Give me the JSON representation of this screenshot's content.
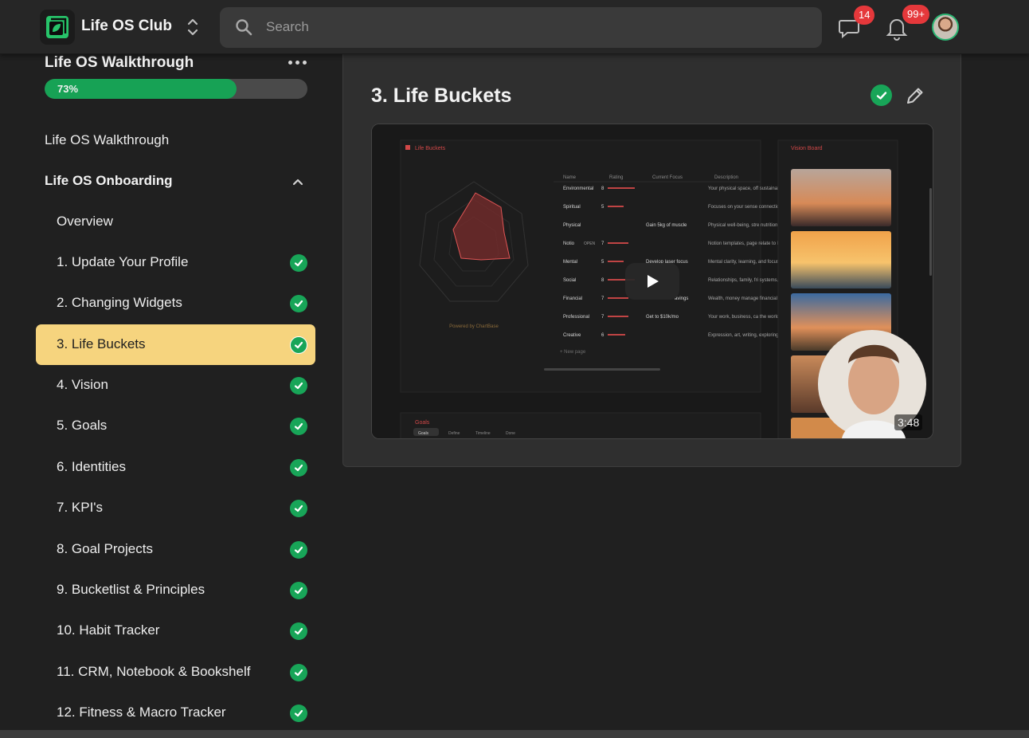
{
  "header": {
    "club_name": "Life OS Club",
    "search_placeholder": "Search",
    "messages_badge": "14",
    "notifications_badge": "99+"
  },
  "sidebar": {
    "course_title": "Life OS Walkthrough",
    "progress": {
      "value_percent": 73,
      "label": "73%"
    },
    "links": [
      {
        "label": "Life OS Walkthrough"
      }
    ],
    "section": {
      "title": "Life OS Onboarding",
      "expanded": true
    },
    "items": [
      {
        "label": "Overview",
        "completed": false
      },
      {
        "label": "1. Update Your Profile",
        "completed": true
      },
      {
        "label": "2. Changing Widgets",
        "completed": true
      },
      {
        "label": "3. Life Buckets",
        "completed": true,
        "active": true
      },
      {
        "label": "4. Vision",
        "completed": true
      },
      {
        "label": "5. Goals",
        "completed": true
      },
      {
        "label": "6. Identities",
        "completed": true
      },
      {
        "label": "7. KPI's",
        "completed": true
      },
      {
        "label": "8. Goal Projects",
        "completed": true
      },
      {
        "label": "9. Bucketlist & Principles",
        "completed": true
      },
      {
        "label": "10. Habit Tracker",
        "completed": true
      },
      {
        "label": "11. CRM, Notebook & Bookshelf",
        "completed": true
      },
      {
        "label": "12. Fitness & Macro Tracker",
        "completed": true
      }
    ]
  },
  "lesson": {
    "title": "3. Life Buckets",
    "video": {
      "duration": "3:48",
      "embedded": {
        "panel_title": "Life Buckets",
        "vision_title": "Vision Board",
        "goals_title": "Goals",
        "columns": [
          "Name",
          "Rating",
          "Current Focus",
          "Description"
        ],
        "rows": [
          {
            "name": "Environmental",
            "rating": "8",
            "focus": "",
            "desc": "Your physical space, off sustainability, and envir"
          },
          {
            "name": "Spiritual",
            "rating": "5",
            "focus": "",
            "desc": "Focuses on your sense connection to somethin"
          },
          {
            "name": "Physical",
            "rating": "",
            "focus": "Gain 5kg of muscle",
            "desc": "Physical well-being, stre nutrition, and vitality"
          },
          {
            "name": "Notio",
            "rating": "7",
            "focus": "",
            "desc": "Notion templates, page relate to Life Buckets"
          },
          {
            "name": "Mental",
            "rating": "5",
            "focus": "Develop laser focus",
            "desc": "Mental clarity, learning, and focus"
          },
          {
            "name": "Social",
            "rating": "8",
            "focus": "",
            "desc": "Relationships, family, fri systems, networking, ar"
          },
          {
            "name": "Financial",
            "rating": "7",
            "focus": "avings",
            "desc": "Wealth, money manage financial stability, and lo"
          },
          {
            "name": "Professional",
            "rating": "7",
            "focus": "Get to $10k/mo",
            "desc": "Your work, business, ca the world"
          },
          {
            "name": "Creative",
            "rating": "6",
            "focus": "",
            "desc": "Expression, art, writing, exploring new ideas"
          }
        ],
        "powered_by": "Powered by ChartBase",
        "new_page": "+ New page",
        "open_tag": "OPEN",
        "goals_tabs": [
          "Goals",
          "Define",
          "Timeline",
          "Done"
        ]
      }
    }
  },
  "colors": {
    "accent_green": "#18a558",
    "active_item": "#f6d47e",
    "badge_red": "#e5383b"
  }
}
